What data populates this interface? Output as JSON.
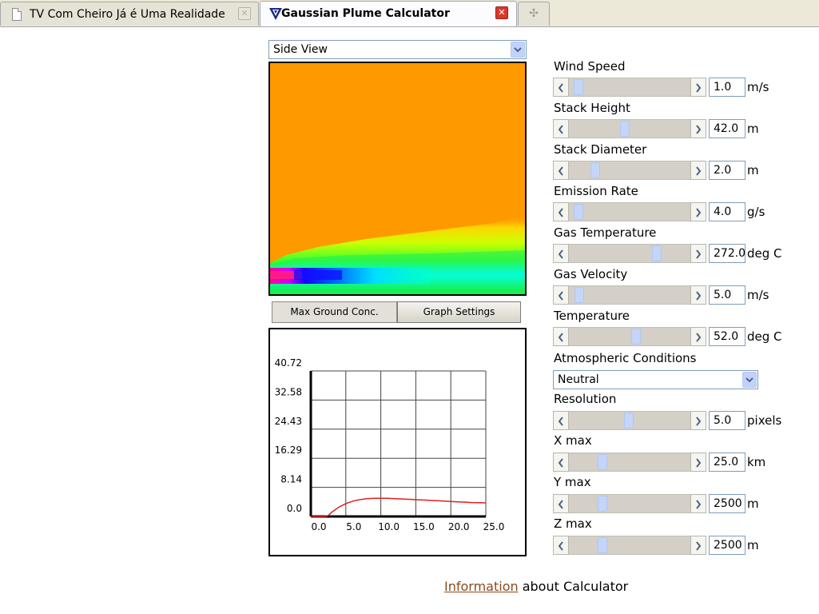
{
  "tabs": [
    {
      "label": "TV Com Cheiro Já é Uma Realidade",
      "active": false
    },
    {
      "label": "Gaussian Plume Calculator",
      "active": true
    }
  ],
  "view_select": {
    "value": "Side View"
  },
  "buttons": {
    "max_ground": "Max Ground Conc.",
    "graph_settings": "Graph Settings"
  },
  "params": [
    {
      "label": "Wind Speed",
      "value": "1.0",
      "unit": "m/s",
      "position": 0.04
    },
    {
      "label": "Stack Height",
      "value": "42.0",
      "unit": "m",
      "position": 0.46
    },
    {
      "label": "Stack Diameter",
      "value": "2.0",
      "unit": "m",
      "position": 0.19
    },
    {
      "label": "Emission Rate",
      "value": "4.0",
      "unit": "g/s",
      "position": 0.04
    },
    {
      "label": "Gas Temperature",
      "value": "272.0",
      "unit": "deg C",
      "position": 0.74
    },
    {
      "label": "Gas Velocity",
      "value": "5.0",
      "unit": "m/s",
      "position": 0.05
    },
    {
      "label": "Temperature",
      "value": "52.0",
      "unit": "deg C",
      "position": 0.56
    },
    {
      "label": "Resolution",
      "value": "5.0",
      "unit": "pixels",
      "position": 0.49
    },
    {
      "label": "X max",
      "value": "25.0",
      "unit": "km",
      "position": 0.26
    },
    {
      "label": "Y max",
      "value": "2500",
      "unit": "m",
      "position": 0.26
    },
    {
      "label": "Z max",
      "value": "2500",
      "unit": "m",
      "position": 0.26
    }
  ],
  "atmospheric": {
    "label": "Atmospheric Conditions",
    "value": "Neutral"
  },
  "info": {
    "link": "Information",
    "rest": " about Calculator"
  },
  "chart_data": {
    "type": "line",
    "x_ticks": [
      "0.0",
      "5.0",
      "10.0",
      "15.0",
      "20.0",
      "25.0"
    ],
    "y_ticks": [
      "0.0",
      "8.14",
      "16.29",
      "24.43",
      "32.58",
      "40.72"
    ],
    "xlim": [
      0,
      25
    ],
    "ylim": [
      0,
      40.72
    ],
    "grid": true,
    "series": [
      {
        "color": "#e02020",
        "x": [
          0,
          2,
          2.5,
          3,
          4,
          5,
          6,
          7,
          8,
          9,
          10,
          11,
          12,
          13,
          14,
          15,
          16,
          17,
          18,
          19,
          20,
          21,
          22,
          23,
          24,
          25
        ],
        "y": [
          0,
          0,
          0.3,
          1.2,
          2.6,
          3.6,
          4.3,
          4.7,
          5.0,
          5.1,
          5.1,
          5.1,
          5.0,
          4.9,
          4.8,
          4.7,
          4.6,
          4.5,
          4.4,
          4.3,
          4.2,
          4.1,
          4.0,
          3.9,
          3.85,
          3.8
        ]
      }
    ]
  },
  "colors": {
    "plume_background": "#ff9900",
    "accent_red": "#e02020"
  }
}
